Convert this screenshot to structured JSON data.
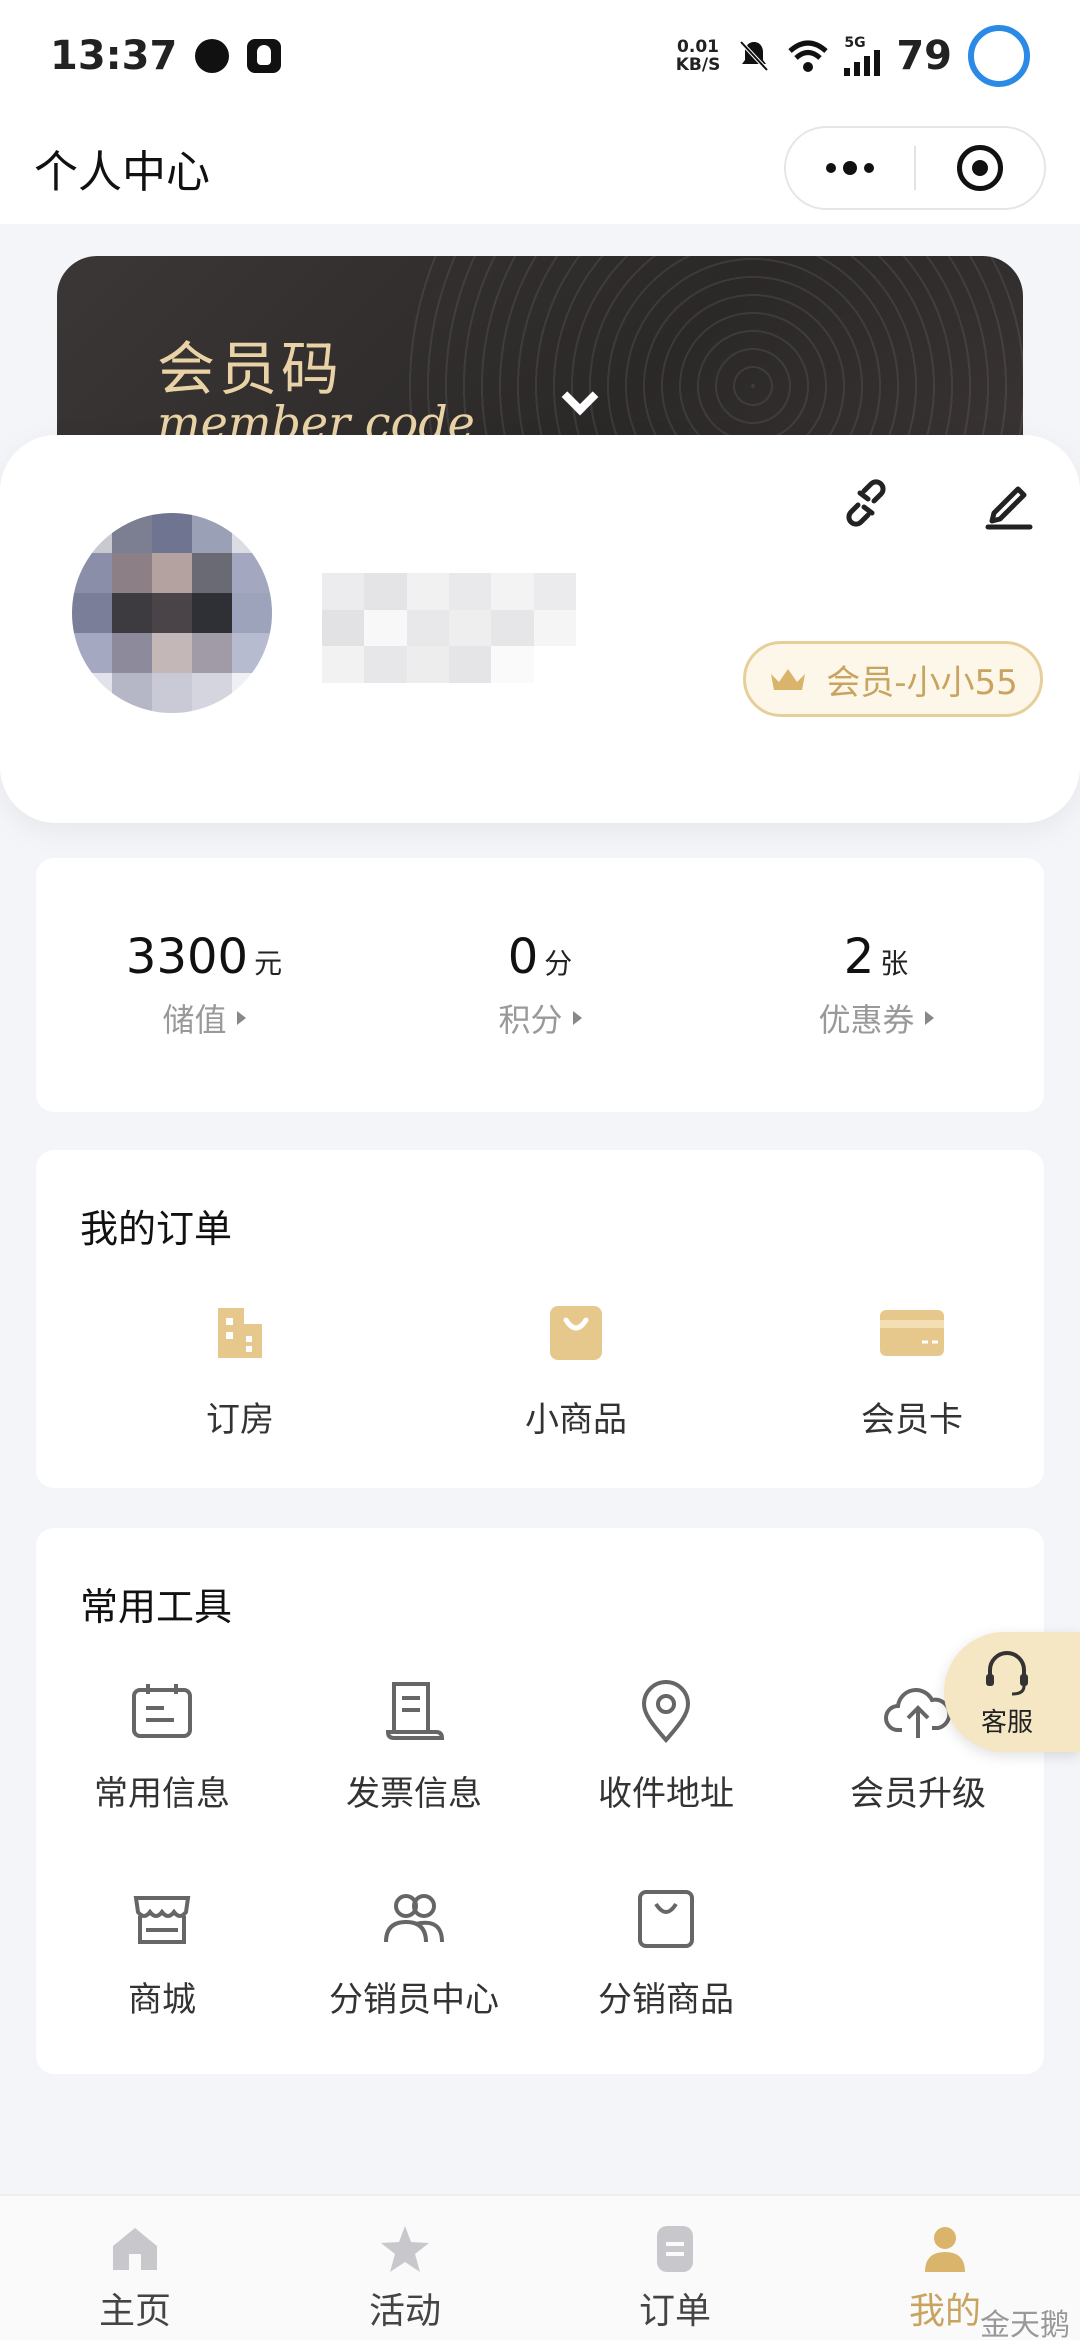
{
  "status_bar": {
    "time": "13:37",
    "net_speed_top": "0.01",
    "net_speed_bottom": "KB/S",
    "network": "5G",
    "battery": "79"
  },
  "header": {
    "title": "个人中心"
  },
  "member_code": {
    "title": "会员码",
    "subtitle": "member code"
  },
  "profile": {
    "badge_label": "会员-小小55"
  },
  "assets": [
    {
      "value": "3300",
      "unit": "元",
      "label": "储值"
    },
    {
      "value": "0",
      "unit": "分",
      "label": "积分"
    },
    {
      "value": "2",
      "unit": "张",
      "label": "优惠券"
    }
  ],
  "orders": {
    "title": "我的订单",
    "items": [
      {
        "label": "订房",
        "icon": "building-icon"
      },
      {
        "label": "小商品",
        "icon": "shopping-bag-icon"
      },
      {
        "label": "会员卡",
        "icon": "member-card-icon"
      }
    ]
  },
  "tools": {
    "title": "常用工具",
    "items": [
      {
        "label": "常用信息",
        "icon": "calendar-note-icon"
      },
      {
        "label": "发票信息",
        "icon": "invoice-icon"
      },
      {
        "label": "收件地址",
        "icon": "location-pin-icon"
      },
      {
        "label": "会员升级",
        "icon": "cloud-upload-icon"
      },
      {
        "label": "商城",
        "icon": "store-icon"
      },
      {
        "label": "分销员中心",
        "icon": "users-icon"
      },
      {
        "label": "分销商品",
        "icon": "bag-icon"
      }
    ]
  },
  "service": {
    "label": "客服"
  },
  "tab_bar": {
    "tabs": [
      {
        "label": "主页",
        "icon": "home-icon"
      },
      {
        "label": "活动",
        "icon": "star-icon"
      },
      {
        "label": "订单",
        "icon": "order-list-icon"
      },
      {
        "label": "我的",
        "icon": "user-icon"
      }
    ],
    "active_index": 3
  },
  "watermark": "金天鹅",
  "colors": {
    "accent_gold": "#c9a461",
    "light_gold": "#e6cf9a",
    "page_bg": "#f4f5f9"
  }
}
